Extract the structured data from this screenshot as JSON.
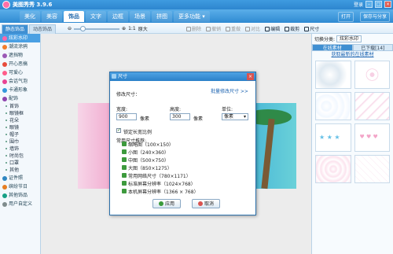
{
  "app": {
    "title": "美图秀秀 3.9.6",
    "user": "登录",
    "window_buttons": [
      "-",
      "□",
      "×"
    ]
  },
  "nav": {
    "tabs": [
      {
        "label": "美化"
      },
      {
        "label": "美容"
      },
      {
        "label": "饰品"
      },
      {
        "label": "文字"
      },
      {
        "label": "边框"
      },
      {
        "label": "场景"
      },
      {
        "label": "拼图"
      },
      {
        "label": "更多功能 ▾"
      }
    ],
    "active_tab": "饰品",
    "right_buttons": [
      "打开",
      "保存与分享"
    ]
  },
  "toolbar": {
    "tabs": [
      "静态饰品",
      "动态饰品"
    ],
    "active_tab": "静态饰品",
    "zoom_label": "1:1",
    "zoom_reset": "原大",
    "tools": [
      {
        "label": "删除",
        "enabled": false
      },
      {
        "label": "撤销",
        "enabled": false
      },
      {
        "label": "重做",
        "enabled": false
      },
      {
        "label": "对比",
        "enabled": false
      },
      {
        "label": "编辑",
        "enabled": true
      },
      {
        "label": "裁剪",
        "enabled": true
      },
      {
        "label": "尺寸",
        "enabled": true
      }
    ]
  },
  "sidebar": {
    "items": [
      {
        "label": "炫彩水印",
        "active": true,
        "color": "#ff66a8"
      },
      {
        "label": "潮流涂鸦",
        "active": false,
        "color": "#f37c2b"
      },
      {
        "label": "遮挡物",
        "active": false,
        "color": "#9b59b6"
      },
      {
        "label": "开心恶搞",
        "active": false,
        "color": "#e74c3c"
      },
      {
        "label": "可爱心",
        "active": false,
        "color": "#ff5c8a"
      },
      {
        "label": "会话气泡",
        "active": false,
        "color": "#e84393"
      },
      {
        "label": "卡通形象",
        "active": false,
        "color": "#3498db"
      },
      {
        "label": "配饰",
        "active": false,
        "color": "#8e44ad"
      }
    ],
    "subitems": [
      "首饰",
      "眼镜框",
      "花朵",
      "眼镜",
      "帽子",
      "围巾",
      "墙饰",
      "时尚包",
      "口罩",
      "其他"
    ],
    "bottom_items": [
      {
        "label": "证件照",
        "color": "#2e86c1"
      },
      {
        "label": "缤纷节日",
        "color": "#e67e22"
      },
      {
        "label": "其他饰品",
        "color": "#16a085"
      },
      {
        "label": "用户自定义",
        "color": "#7f8c8d"
      }
    ]
  },
  "rightpanel": {
    "category_label": "切换分类:",
    "category_value": "炫彩水印",
    "tabs": [
      "在线素材",
      "已下载[14]"
    ],
    "active_tab": "在线素材",
    "link": "获取最新的在线素材",
    "thumbs": [
      "thumb-1",
      "thumb-2",
      "thumb-3",
      "thumb-4",
      "thumb-5",
      "thumb-6",
      "thumb-7",
      "thumb-8"
    ]
  },
  "dialog": {
    "title": "尺寸",
    "section_label": "修改尺寸：",
    "batch_link": "批量修改尺寸 >>",
    "width_label": "宽度:",
    "width_value": "900",
    "width_unit": "像素",
    "height_label": "高度:",
    "height_value": "300",
    "height_unit": "像素",
    "unit_label": "单位:",
    "unit_value": "像素",
    "lock_ratio_label": "锁定长宽比例",
    "presets_label": "常用尺寸推荐:",
    "presets": [
      "缩略图（100×150）",
      "小图（240×360）",
      "中图（500×750）",
      "大图（850×1275）",
      "常用网络尺寸（780×1171）",
      "标准屏幕分辨率（1024×768）",
      "本机屏幕分辨率（1366 × 768）"
    ],
    "ok_label": "应用",
    "cancel_label": "取消"
  }
}
